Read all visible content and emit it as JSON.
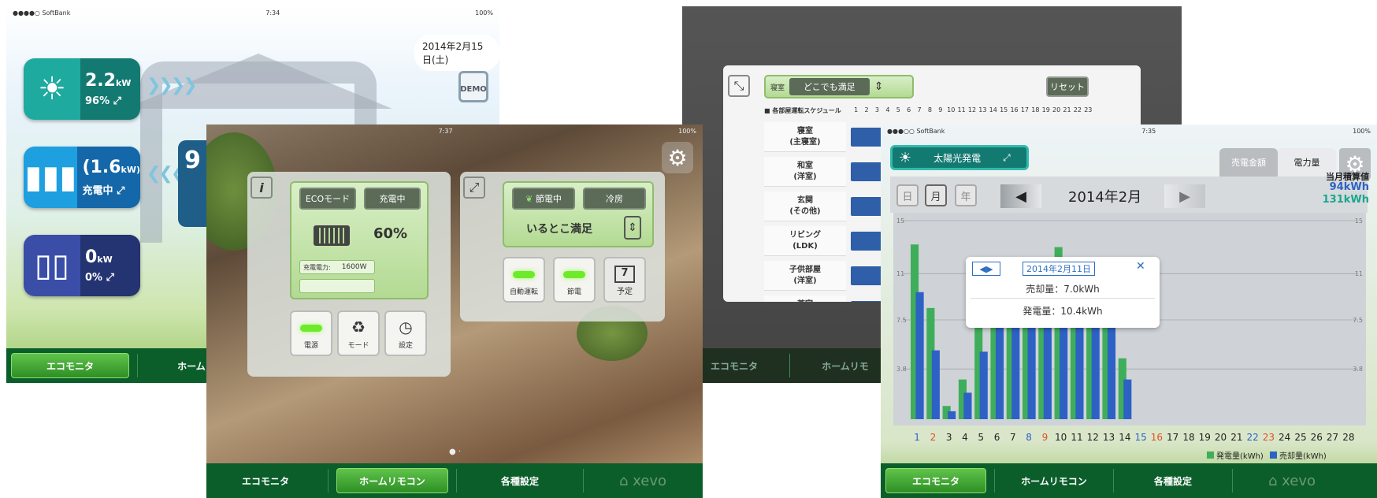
{
  "screen1": {
    "status": {
      "carrier": "●●●●○ SoftBank",
      "time": "7:34",
      "battery": "100%"
    },
    "date": "2014年2月15日(土)",
    "demo_label": "DEMO",
    "solar": {
      "value": "2.2",
      "unit": "kW",
      "percent": "96%"
    },
    "battery": {
      "value": "(1.6",
      "unit": "kW)",
      "state": "充電中"
    },
    "grid": {
      "value": "0",
      "unit": "kW",
      "percent": "0%"
    },
    "center_value": "9",
    "tabs": [
      "エコモニタ",
      "ホームリモ"
    ]
  },
  "screen2": {
    "status": {
      "time": "7:37",
      "battery": "100%"
    },
    "left_panel": {
      "eco_mode": "ECOモード",
      "charging": "充電中",
      "battery_percent": "60%",
      "charge_power_label": "充電電力:",
      "charge_power_value": "1600W",
      "power_btn": "電源",
      "mode_btn": "モード",
      "settings_btn": "設定"
    },
    "right_panel": {
      "saving": "節電中",
      "cooling": "冷房",
      "mode_name": "いるとこ満足",
      "auto_btn": "自動運転",
      "save_btn": "節電",
      "schedule_btn": "予定",
      "schedule_num": "7"
    },
    "tabs": [
      "エコモニタ",
      "ホームリモコン",
      "各種設定",
      "xevo"
    ]
  },
  "screen3": {
    "room_selected": "寝室",
    "mode": "どこでも満足",
    "reset": "リセット",
    "schedule_title": "■ 各部屋運転スケジュール",
    "hours": [
      "1",
      "2",
      "3",
      "4",
      "5",
      "6",
      "7",
      "8",
      "9",
      "10",
      "11",
      "12",
      "13",
      "14",
      "15",
      "16",
      "17",
      "18",
      "19",
      "20",
      "21",
      "22",
      "23"
    ],
    "rooms": [
      {
        "name": "寝室",
        "sub": "(主寝室)"
      },
      {
        "name": "和室",
        "sub": "(洋室)"
      },
      {
        "name": "玄関",
        "sub": "(その他)"
      },
      {
        "name": "リビング",
        "sub": "(LDK)"
      },
      {
        "name": "子供部屋",
        "sub": "(洋室)"
      },
      {
        "name": "茶室",
        "sub": ""
      }
    ],
    "tabs": [
      "エコモニタ",
      "ホームリモ"
    ]
  },
  "screen4": {
    "status": {
      "carrier": "●●●○○ SoftBank",
      "time": "7:35",
      "battery": "100%"
    },
    "source": "太陽光発電",
    "tab_sales": "売電金額",
    "tab_power": "電力量",
    "period_day": "日",
    "period_month": "月",
    "period_year": "年",
    "month_title": "2014年2月",
    "total_label": "当月積算値",
    "total_sold": "94kWh",
    "total_gen": "131kWh",
    "tooltip": {
      "date": "2014年2月11日",
      "sold": "売却量：7.0kWh",
      "gen": "発電量：10.4kWh"
    },
    "legend_gen": "発電量(kWh)",
    "legend_sold": "売却量(kWh)",
    "colors": {
      "gen": "#3fae5a",
      "sold": "#2d62c4",
      "holiday_red": "#e0502a",
      "weekend_blue": "#2d62c4"
    },
    "tabs": [
      "エコモニタ",
      "ホームリモコン",
      "各種設定",
      "xevo"
    ]
  },
  "chart_data": {
    "type": "bar",
    "title": "2014年2月",
    "categories": [
      "1",
      "2",
      "3",
      "4",
      "5",
      "6",
      "7",
      "8",
      "9",
      "10",
      "11",
      "12",
      "13",
      "14",
      "15",
      "16",
      "17",
      "18",
      "19",
      "20",
      "21",
      "22",
      "23",
      "24",
      "25",
      "26",
      "27",
      "28"
    ],
    "ylim": [
      0,
      15
    ],
    "yticks": [
      "15",
      "11",
      "7.5",
      "3.8"
    ],
    "series": [
      {
        "name": "発電量(kWh)",
        "values": [
          13.2,
          8.4,
          1.0,
          3.0,
          8.3,
          11.0,
          11.0,
          11.0,
          11.0,
          13.0,
          10.4,
          11.0,
          11.0,
          4.6,
          0,
          0,
          0,
          0,
          0,
          0,
          0,
          0,
          0,
          0,
          0,
          0,
          0,
          0
        ]
      },
      {
        "name": "売却量(kWh)",
        "values": [
          9.6,
          5.2,
          0.6,
          2.0,
          5.1,
          7.5,
          7.5,
          7.5,
          7.5,
          8.5,
          7.0,
          7.5,
          7.5,
          3.0,
          0,
          0,
          0,
          0,
          0,
          0,
          0,
          0,
          0,
          0,
          0,
          0,
          0,
          0
        ]
      }
    ]
  }
}
